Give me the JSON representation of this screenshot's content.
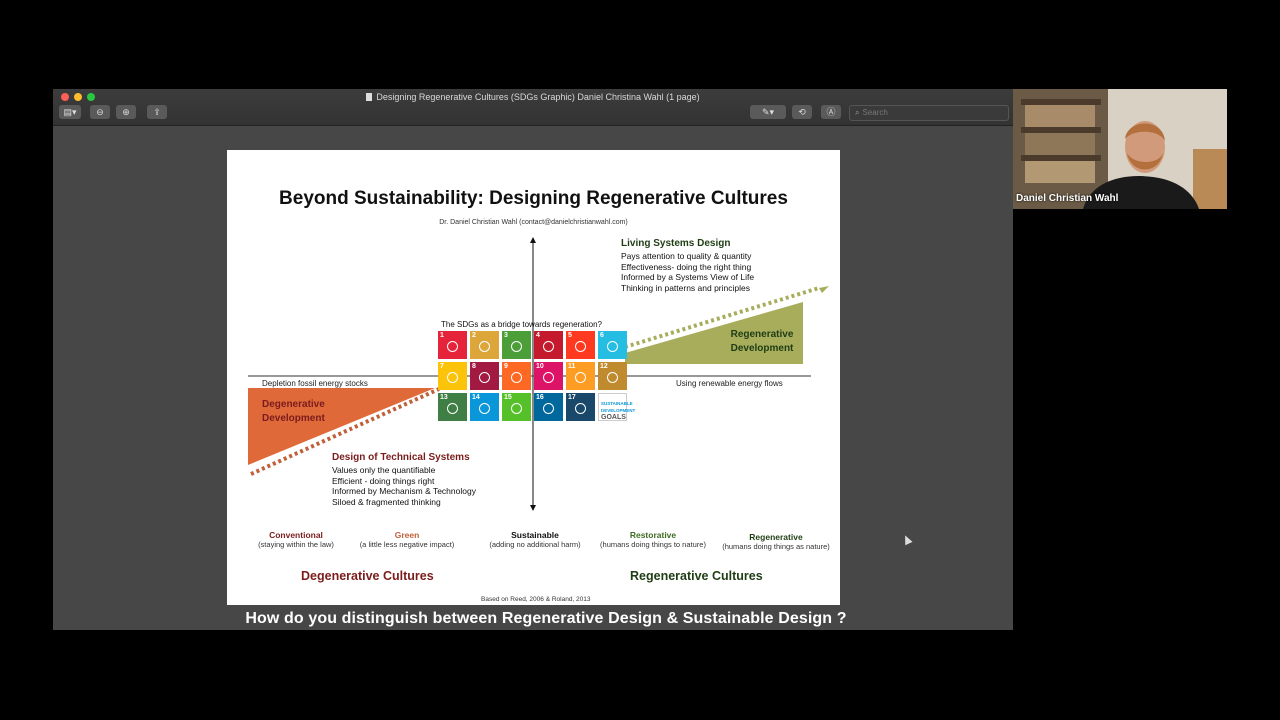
{
  "window": {
    "title": "Designing Regenerative Cultures (SDGs Graphic) Daniel Christina Wahl (1 page)",
    "search_placeholder": "Search"
  },
  "traffic_colors": [
    "#fe5f57",
    "#febc2e",
    "#28c840"
  ],
  "doc": {
    "title": "Beyond Sustainability: Designing Regenerative Cultures",
    "author": "Dr. Daniel Christian Wahl (contact@danielchristianwahl.com)",
    "living_heading": "Living Systems Design",
    "living_lines": [
      "Pays attention to quality & quantity",
      "Effectiveness- doing the right thing",
      "Informed by a Systems View of Life",
      "Thinking in patterns and principles"
    ],
    "technical_heading": "Design of Technical Systems",
    "technical_lines": [
      "Values only the quantifiable",
      "Efficient - doing things right",
      "Informed by Mechanism & Technology",
      "Siloed & fragmented thinking"
    ],
    "bridge": "The SDGs as a bridge towards regeneration?",
    "regen_dev": [
      "Regenerative",
      "Development"
    ],
    "degen_dev": [
      "Degenerative",
      "Development"
    ],
    "fossil": "Depletion fossil energy stocks",
    "renewable": "Using renewable energy flows",
    "sdg_last": [
      "SUSTAINABLE",
      "DEVELOPMENT",
      "GOALS"
    ],
    "stages": [
      {
        "label": "Conventional",
        "sub": "(staying within the law)",
        "color": "#7a1c1c"
      },
      {
        "label": "Green",
        "sub": "(a little less negative impact)",
        "color": "#c0603a"
      },
      {
        "label": "Sustainable",
        "sub": "(adding no additional harm)",
        "color": "#111111"
      },
      {
        "label": "Restorative",
        "sub": "(humans doing things to nature)",
        "color": "#3f6b22"
      },
      {
        "label": "Regenerative",
        "sub": "(humans doing things as nature)",
        "color": "#1e3d14"
      }
    ],
    "degen_cultures": "Degenerative Cultures",
    "regen_cultures": "Regenerative Cultures",
    "footer": "Based on Reed, 2006 & Roland, 2013"
  },
  "sdg_colors": [
    "#e5243b",
    "#dda63a",
    "#4c9f38",
    "#c5192d",
    "#ff3a21",
    "#26bde2",
    "#fcc30b",
    "#a21942",
    "#fd6925",
    "#dd1367",
    "#fd9d24",
    "#bf8b2e",
    "#3f7e44",
    "#0a97d9",
    "#56c02b",
    "#00689d",
    "#19486a",
    "#ffffff"
  ],
  "participant": {
    "name": "Daniel Christian Wahl"
  },
  "caption": "How do you distinguish between Regenerative Design & Sustainable Design ?"
}
